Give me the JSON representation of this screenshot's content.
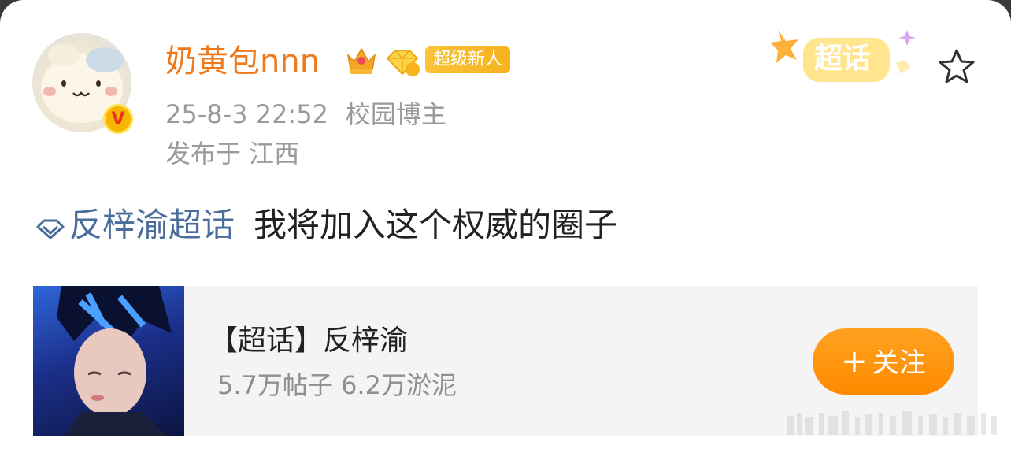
{
  "post": {
    "username": "奶黄包nnn",
    "newcomer_badge": "超级新人",
    "time": "25-8-3 22:52",
    "role": "校园博主",
    "location": "发布于 江西",
    "supertopic_sticker": "超话",
    "topic_link": "反梓渝超话",
    "text": "我将加入这个权威的圈子"
  },
  "topic_card": {
    "title": "【超话】反梓渝",
    "stats": "5.7万帖子 6.2万淤泥",
    "follow_label": "关注"
  },
  "colors": {
    "username": "#ee7a1b",
    "topic_link": "#4a6d9c",
    "follow_button": "#ff8a00",
    "newcomer_badge": "#f7b21d"
  },
  "icons": [
    "crown-icon",
    "diamond-badge-icon",
    "verified-badge-icon",
    "star-icon",
    "supertopic-diamond-icon",
    "plus-icon"
  ]
}
